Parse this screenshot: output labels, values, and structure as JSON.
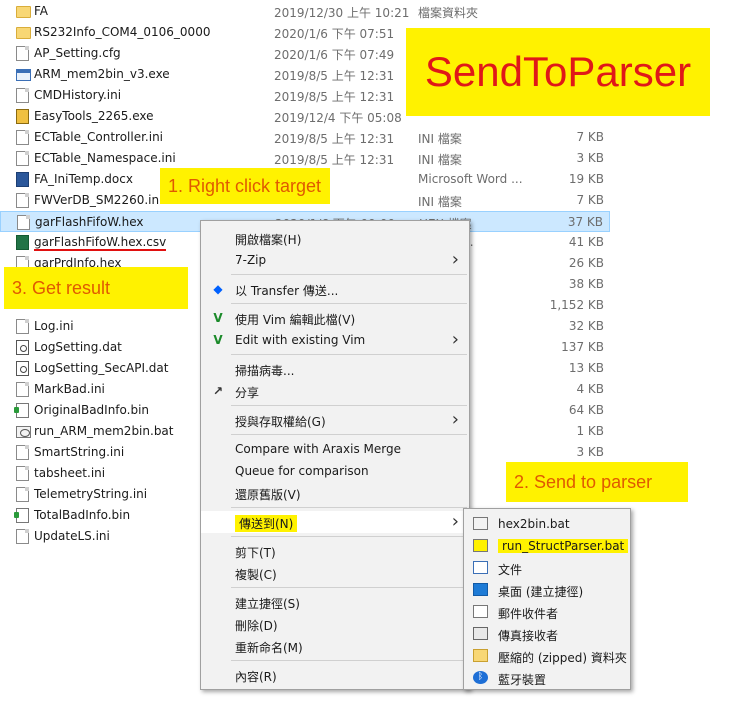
{
  "files": [
    {
      "name": "FA",
      "date": "2019/12/30 上午 10:21",
      "type": "檔案資料夾",
      "size": "",
      "icon": "folder-icon"
    },
    {
      "name": "RS232Info_COM4_0106_0000",
      "date": "2020/1/6 下午 07:51",
      "type": "",
      "size": "",
      "icon": "folder-icon"
    },
    {
      "name": "AP_Setting.cfg",
      "date": "2020/1/6 下午 07:49",
      "type": "",
      "size": "",
      "icon": "document-icon"
    },
    {
      "name": "ARM_mem2bin_v3.exe",
      "date": "2019/8/5 上午 12:31",
      "type": "",
      "size": "",
      "icon": "exe-icon"
    },
    {
      "name": "CMDHistory.ini",
      "date": "2019/8/5 上午 12:31",
      "type": "",
      "size": "",
      "icon": "document-icon"
    },
    {
      "name": "EasyTools_2265.exe",
      "date": "2019/12/4 下午 05:08",
      "type": "",
      "size": "",
      "icon": "tool-icon"
    },
    {
      "name": "ECTable_Controller.ini",
      "date": "2019/8/5 上午 12:31",
      "type": "INI 檔案",
      "size": "7 KB",
      "icon": "document-icon"
    },
    {
      "name": "ECTable_Namespace.ini",
      "date": "2019/8/5 上午 12:31",
      "type": "INI 檔案",
      "size": "3 KB",
      "icon": "document-icon"
    },
    {
      "name": "FA_IniTemp.docx",
      "date": "12:31",
      "type": "Microsoft Word ...",
      "size": "19 KB",
      "icon": "word-icon"
    },
    {
      "name": "FWVerDB_SM2260.ini",
      "date": "12:31",
      "type": "INI 檔案",
      "size": "7 KB",
      "icon": "document-icon"
    },
    {
      "name": "garFlashFifoW.hex",
      "date": "2020/1/6 下午 09:00",
      "type": "HEX 檔案",
      "size": "37 KB",
      "icon": "document-icon",
      "selected": true
    },
    {
      "name": "garFlashFifoW.hex.csv",
      "date": "",
      "type": "t Excel ...",
      "size": "41 KB",
      "icon": "excel-icon",
      "underline": true
    },
    {
      "name": "garPrdInfo.hex",
      "date": "",
      "type": "",
      "size": "26 KB",
      "icon": "document-icon"
    },
    {
      "name": "",
      "date": "",
      "type": "",
      "size": "38 KB",
      "icon": ""
    },
    {
      "name": "",
      "date": "",
      "type": "",
      "size": "1,152 KB",
      "icon": ""
    },
    {
      "name": "Log.ini",
      "date": "",
      "type": "",
      "size": "32 KB",
      "icon": "document-icon"
    },
    {
      "name": "LogSetting.dat",
      "date": "",
      "type": "",
      "size": "137 KB",
      "icon": "gear-icon"
    },
    {
      "name": "LogSetting_SecAPI.dat",
      "date": "",
      "type": "",
      "size": "13 KB",
      "icon": "gear-icon"
    },
    {
      "name": "MarkBad.ini",
      "date": "",
      "type": "",
      "size": "4 KB",
      "icon": "document-icon"
    },
    {
      "name": "OriginalBadInfo.bin",
      "date": "",
      "type": "",
      "size": "64 KB",
      "icon": "bin-icon"
    },
    {
      "name": "run_ARM_mem2bin.bat",
      "date": "",
      "type": "批次檔案",
      "size": "1 KB",
      "icon": "bat-icon"
    },
    {
      "name": "SmartString.ini",
      "date": "",
      "type": "",
      "size": "3 KB",
      "icon": "document-icon"
    },
    {
      "name": "tabsheet.ini",
      "date": "",
      "type": "",
      "size": "",
      "icon": "document-icon"
    },
    {
      "name": "TelemetryString.ini",
      "date": "",
      "type": "",
      "size": "",
      "icon": "document-icon"
    },
    {
      "name": "TotalBadInfo.bin",
      "date": "",
      "type": "",
      "size": "",
      "icon": "bin-icon"
    },
    {
      "name": "UpdateLS.ini",
      "date": "",
      "type": "",
      "size": "",
      "icon": "document-icon"
    }
  ],
  "annotations": {
    "title": "SendToParser",
    "step1": "1. Right click target",
    "step2": "2. Send to parser",
    "step3": "3. Get result"
  },
  "context_menu": [
    {
      "label": "開啟檔案(H)",
      "icon": "",
      "arrow": false
    },
    {
      "label": "7-Zip",
      "icon": "",
      "arrow": true
    },
    {
      "sep": true
    },
    {
      "label": "以 Transfer 傳送...",
      "icon": "dropbox-icon",
      "arrow": false
    },
    {
      "sep": true
    },
    {
      "label": "使用 Vim 編輯此檔(V)",
      "icon": "vim-icon",
      "arrow": false
    },
    {
      "label": "Edit with existing Vim",
      "icon": "vim-icon",
      "arrow": true
    },
    {
      "sep": true
    },
    {
      "label": "掃描病毒...",
      "icon": "",
      "arrow": false
    },
    {
      "label": "分享",
      "icon": "share-icon",
      "arrow": false
    },
    {
      "sep": true
    },
    {
      "label": "授與存取權給(G)",
      "icon": "",
      "arrow": true
    },
    {
      "sep": true
    },
    {
      "label": "Compare with Araxis Merge",
      "icon": "",
      "arrow": false
    },
    {
      "label": "Queue for comparison",
      "icon": "",
      "arrow": false
    },
    {
      "label": "還原舊版(V)",
      "icon": "",
      "arrow": false
    },
    {
      "sep": true
    },
    {
      "label": "傳送到(N)",
      "icon": "",
      "arrow": true,
      "hover": true,
      "highlight": true
    },
    {
      "sep": true
    },
    {
      "label": "剪下(T)",
      "icon": "",
      "arrow": false
    },
    {
      "label": "複製(C)",
      "icon": "",
      "arrow": false
    },
    {
      "sep": true
    },
    {
      "label": "建立捷徑(S)",
      "icon": "",
      "arrow": false
    },
    {
      "label": "刪除(D)",
      "icon": "",
      "arrow": false
    },
    {
      "label": "重新命名(M)",
      "icon": "",
      "arrow": false
    },
    {
      "sep": true
    },
    {
      "label": "內容(R)",
      "icon": "",
      "arrow": false
    }
  ],
  "send_to_menu": [
    {
      "label": "hex2bin.bat",
      "icon": "batch-file-icon"
    },
    {
      "label": "run_StructParser.bat",
      "icon": "batch-file-icon",
      "highlight": true
    },
    {
      "label": "文件",
      "icon": "documents-icon"
    },
    {
      "label": "桌面 (建立捷徑)",
      "icon": "desktop-icon"
    },
    {
      "label": "郵件收件者",
      "icon": "mail-icon"
    },
    {
      "label": "傳真接收者",
      "icon": "fax-icon"
    },
    {
      "label": "壓縮的 (zipped) 資料夾",
      "icon": "zip-folder-icon"
    },
    {
      "label": "藍牙裝置",
      "icon": "bluetooth-icon"
    }
  ]
}
